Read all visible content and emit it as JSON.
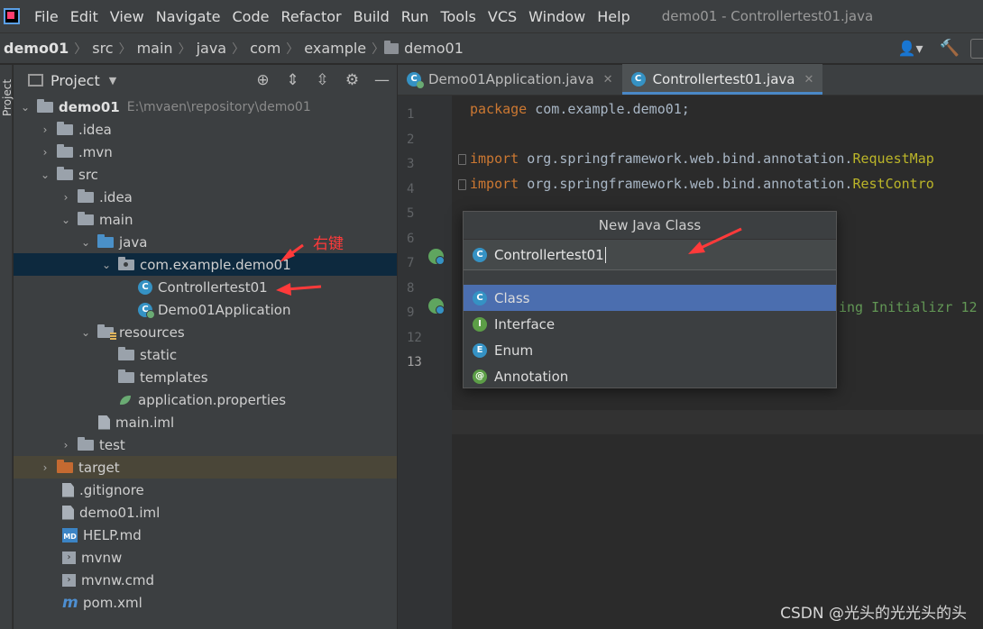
{
  "menubar": {
    "items": [
      "File",
      "Edit",
      "View",
      "Navigate",
      "Code",
      "Refactor",
      "Build",
      "Run",
      "Tools",
      "VCS",
      "Window",
      "Help"
    ],
    "title": "demo01 - Controllertest01.java"
  },
  "breadcrumb": [
    "demo01",
    "src",
    "main",
    "java",
    "com",
    "example",
    "demo01"
  ],
  "sidestrip": {
    "label": "Project"
  },
  "project_panel": {
    "title": "Project",
    "tree": [
      {
        "label": "demo01",
        "hint": "E:\\mvaen\\repository\\demo01"
      },
      {
        "label": ".idea"
      },
      {
        "label": ".mvn"
      },
      {
        "label": "src"
      },
      {
        "label": ".idea"
      },
      {
        "label": "main"
      },
      {
        "label": "java"
      },
      {
        "label": "com.example.demo01"
      },
      {
        "label": "Controllertest01"
      },
      {
        "label": "Demo01Application"
      },
      {
        "label": "resources"
      },
      {
        "label": "static"
      },
      {
        "label": "templates"
      },
      {
        "label": "application.properties"
      },
      {
        "label": "main.iml"
      },
      {
        "label": "test"
      },
      {
        "label": "target"
      },
      {
        "label": ".gitignore"
      },
      {
        "label": "demo01.iml"
      },
      {
        "label": "HELP.md"
      },
      {
        "label": "mvnw"
      },
      {
        "label": "mvnw.cmd"
      },
      {
        "label": "pom.xml"
      }
    ]
  },
  "annotation": {
    "right_click": "右键"
  },
  "editor": {
    "tabs": [
      {
        "label": "Demo01Application.java"
      },
      {
        "label": "Controllertest01.java"
      }
    ],
    "line_numbers": [
      "1",
      "2",
      "3",
      "4",
      "5",
      "6",
      "7",
      "8",
      "9",
      "12",
      "13"
    ],
    "code": {
      "l1_kw": "package",
      "l1_rest": " com.example.demo01;",
      "l3_kw": "import",
      "l3_rest": " org.springframework.web.bind.annotation.",
      "l3_ann": "RequestMap",
      "l4_kw": "import",
      "l4_rest": " org.springframework.web.bind.annotation.",
      "l4_ann": "RestContro",
      "l9_cmt": "ing Initializr 12"
    }
  },
  "popup": {
    "title": "New Java Class",
    "input_value": "Controllertest01",
    "kinds": [
      {
        "label": "Class",
        "letter": "C",
        "color": "#3592c4"
      },
      {
        "label": "Interface",
        "letter": "I",
        "color": "#5c9e47"
      },
      {
        "label": "Enum",
        "letter": "E",
        "color": "#3592c4"
      },
      {
        "label": "Annotation",
        "letter": "@",
        "color": "#5c9e47"
      }
    ]
  },
  "watermark": "CSDN @光头的光光头的头",
  "colors": {
    "accent": "#4a88c7",
    "selection": "#4b6eaf",
    "annotation_red": "#ff3a3a"
  }
}
